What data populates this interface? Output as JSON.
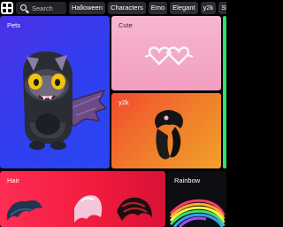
{
  "search": {
    "placeholder": "Search"
  },
  "chips": [
    "Halloween",
    "Characters",
    "Emo",
    "Elegant",
    "y2k",
    "Shirts"
  ],
  "tiles": {
    "pets": {
      "label": "Pets"
    },
    "cute": {
      "label": "Cute"
    },
    "y2k": {
      "label": "y2k"
    },
    "hair": {
      "label": "Hair"
    },
    "rainbow": {
      "label": "Rainbow"
    }
  },
  "icons": [
    "grid-icon",
    "search-icon"
  ],
  "colors": {
    "pets_tile": "#3a3aee",
    "cute_tile": "#f5aac8",
    "y2k_tile": "#f06a2c",
    "hair_tile": "#f0203f",
    "rainbow_tile": "#0d0e12",
    "edge_tile": "#2fe06a"
  }
}
